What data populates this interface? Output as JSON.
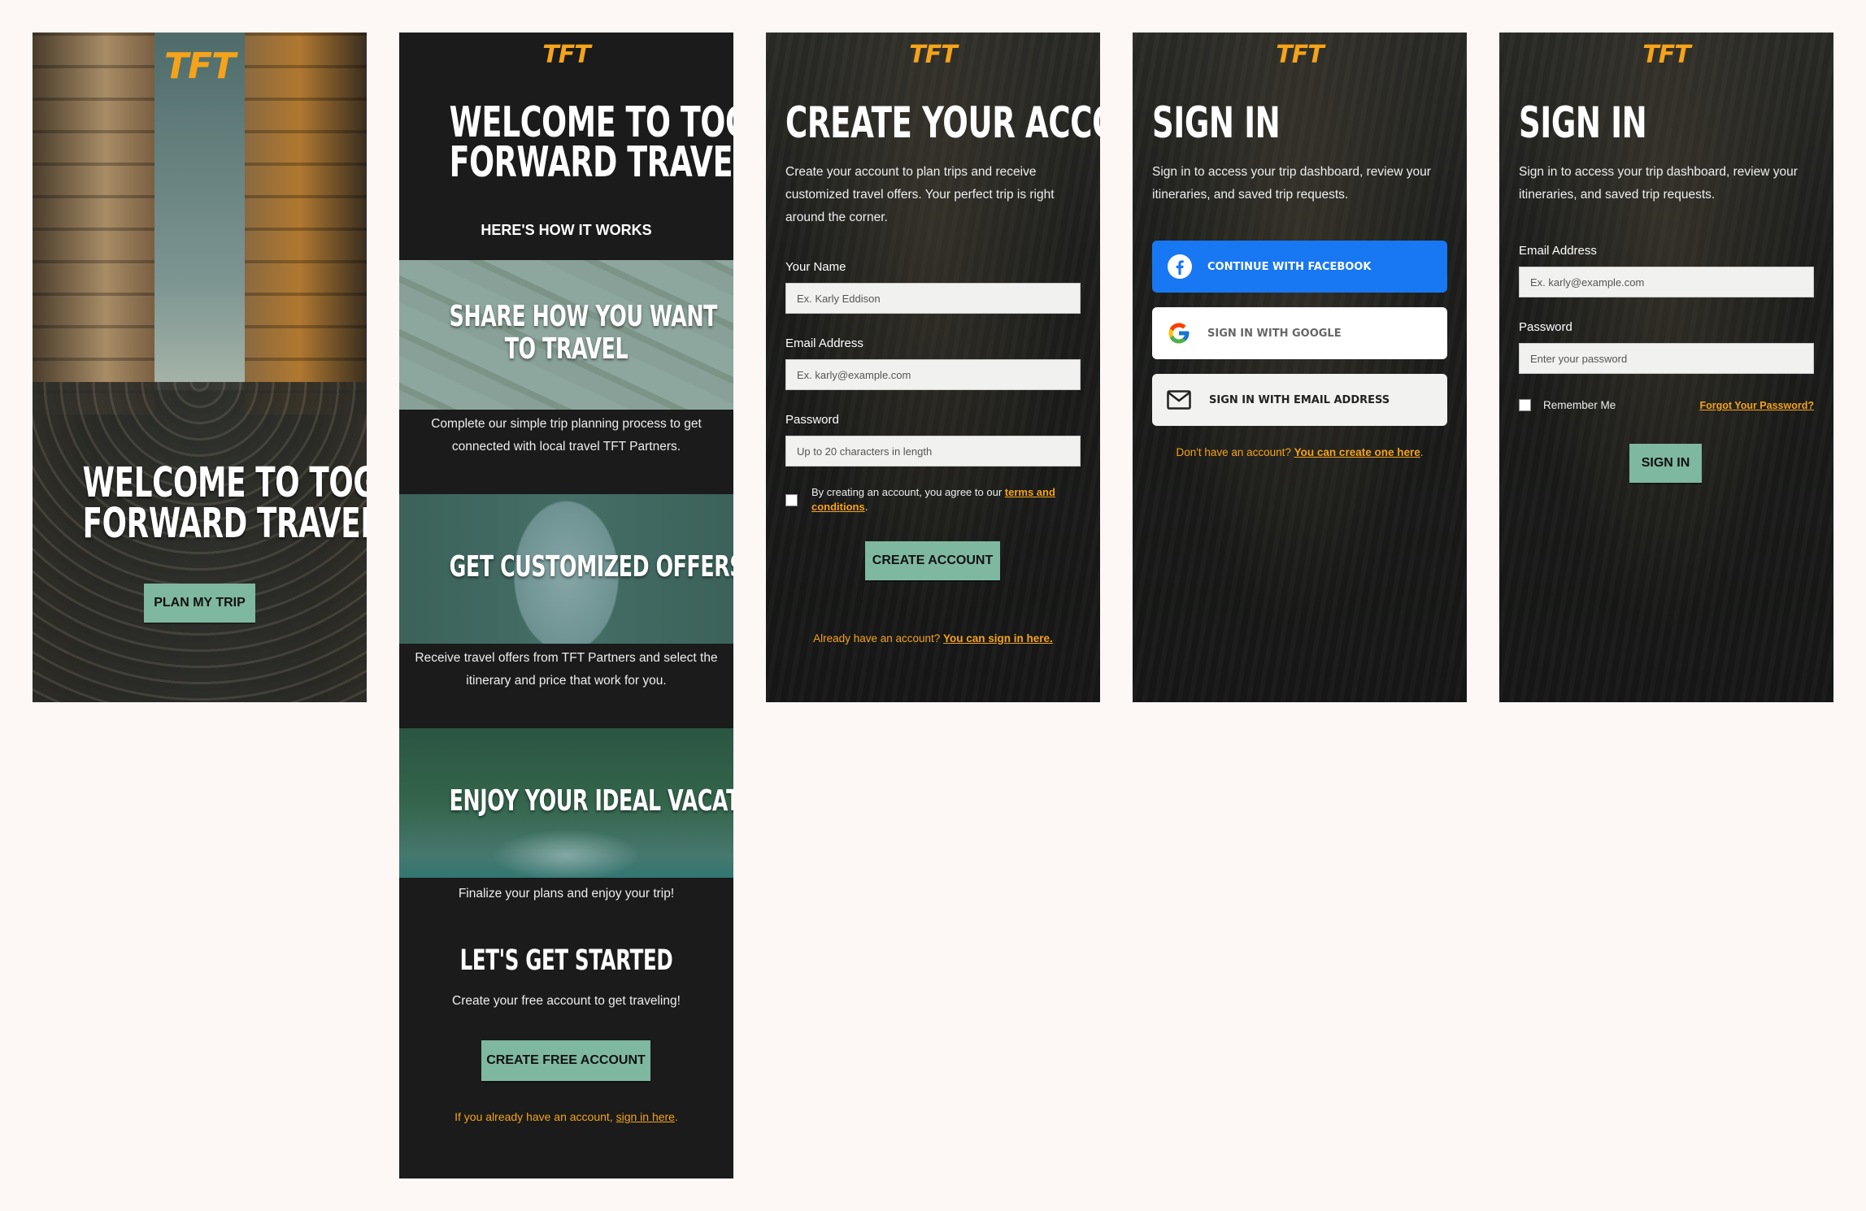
{
  "brand": {
    "logo": "TFT",
    "accent": "#f5a31a",
    "button_green": "#7fb8a0",
    "facebook_blue": "#1877f2"
  },
  "screen1": {
    "title_line1": "WELCOME TO TOGETHER",
    "title_line2": "FORWARD TRAVEL",
    "cta": "PLAN MY TRIP"
  },
  "screen2": {
    "title_line1": "WELCOME TO TOGETHER",
    "title_line2": "FORWARD TRAVEL",
    "subtitle": "HERE'S HOW IT WORKS",
    "steps": [
      {
        "title_line1": "SHARE HOW YOU WANT",
        "title_line2": "TO TRAVEL",
        "desc_line1": "Complete our simple trip planning process to get",
        "desc_line2": "connected with local travel TFT Partners."
      },
      {
        "title_line1": "GET CUSTOMIZED OFFERS",
        "title_line2": "",
        "desc_line1": "Receive travel offers from TFT Partners and select the",
        "desc_line2": "itinerary and price that work for you."
      },
      {
        "title_line1": "ENJOY YOUR IDEAL VACATION",
        "title_line2": "",
        "desc_line1": "Finalize your plans and enjoy your trip!",
        "desc_line2": ""
      }
    ],
    "started_title": "LET'S GET STARTED",
    "started_desc": "Create your free account to get traveling!",
    "cta": "CREATE FREE ACCOUNT",
    "signin_prefix": "If you already have an account, ",
    "signin_link": "sign in here",
    "signin_suffix": "."
  },
  "screen3": {
    "title": "CREATE YOUR ACCOUNT",
    "desc_line1": "Create your account to plan trips and receive",
    "desc_line2": "customized travel offers. Your perfect trip is right",
    "desc_line3": "around the corner.",
    "name_label": "Your Name",
    "name_placeholder": "Ex. Karly Eddison",
    "email_label": "Email Address",
    "email_placeholder": "Ex. karly@example.com",
    "password_label": "Password",
    "password_placeholder": "Up to 20 characters in length",
    "terms_prefix": "By creating an account, you agree to our ",
    "terms_link_1": "terms and",
    "terms_link_2": "conditions",
    "terms_suffix": ".",
    "cta": "CREATE ACCOUNT",
    "signin_prefix": "Already have an account? ",
    "signin_link": "You can sign in here."
  },
  "screen4": {
    "title": "SIGN IN",
    "desc_line1": "Sign in to access your trip dashboard, review your",
    "desc_line2": "itineraries, and saved trip requests.",
    "facebook": "CONTINUE WITH FACEBOOK",
    "google": "SIGN IN WITH GOOGLE",
    "email": "SIGN IN WITH EMAIL ADDRESS",
    "signup_prefix": "Don't have an account? ",
    "signup_link": "You can create one here",
    "signup_suffix": "."
  },
  "screen5": {
    "title": "SIGN IN",
    "desc_line1": "Sign in to access your trip dashboard, review your",
    "desc_line2": "itineraries, and saved trip requests.",
    "email_label": "Email Address",
    "email_placeholder": "Ex. karly@example.com",
    "password_label": "Password",
    "password_placeholder": "Enter your password",
    "remember": "Remember Me",
    "forgot": "Forgot Your Password?",
    "cta": "SIGN IN"
  }
}
